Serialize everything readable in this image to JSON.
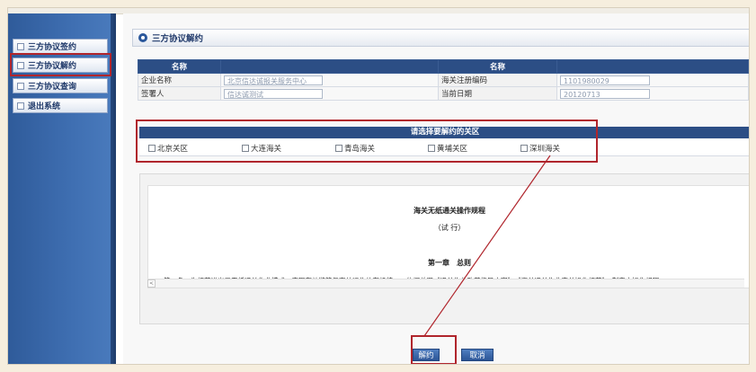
{
  "sidebar": {
    "items": [
      {
        "label": "三方协议签约"
      },
      {
        "label": "三方协议解约"
      },
      {
        "label": "三方协议查询"
      },
      {
        "label": "退出系统"
      }
    ]
  },
  "header": {
    "title": "三方协议解约"
  },
  "info_table": {
    "headers": [
      "名称",
      "",
      "名称",
      ""
    ],
    "rows": [
      {
        "label1": "企业名称",
        "value1": "北京信达诚报关服务中心",
        "label2": "海关注册编码",
        "value2": "1101980029"
      },
      {
        "label1": "签署人",
        "value1": "信达诚测试",
        "label2": "当前日期",
        "value2": "20120713"
      }
    ]
  },
  "customs": {
    "header": "请选择要解约的关区",
    "options": [
      "北京关区",
      "大连海关",
      "青岛海关",
      "黄埔关区",
      "深圳海关"
    ]
  },
  "document": {
    "title": "海关无纸通关操作规程",
    "subtitle": "（试 行）",
    "chapter": "第一章　总则",
    "line": "第一条　为规范进出口无纸通关作业模式，实现有效监管与高效运作的有机统一，依据总署《通关作业改革指导方案》、《海关通关作业审单操作规范》，制定本操作规程。",
    "scroll_left": "<"
  },
  "buttons": {
    "terminate": "解约",
    "cancel": "取消"
  },
  "colors": {
    "accent_red": "#b0252c",
    "header_blue": "#2c4e85",
    "sidebar_blue": "#3f6fb2"
  }
}
